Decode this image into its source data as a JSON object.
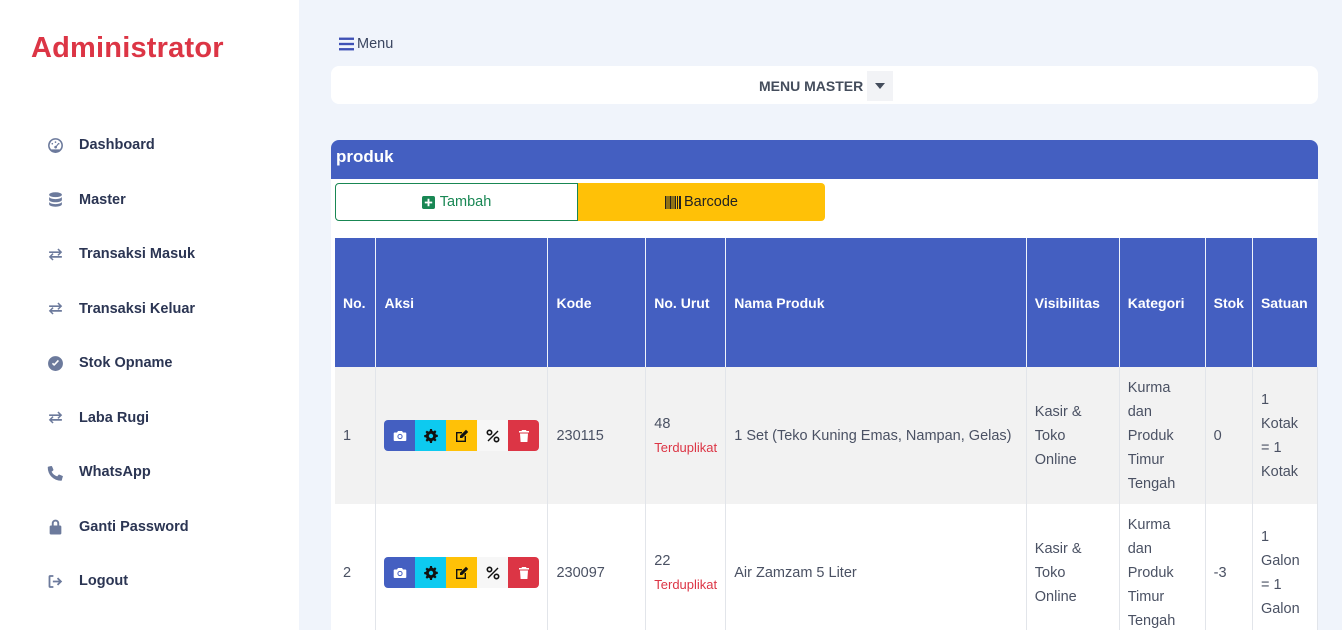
{
  "sidebar": {
    "brand": "Administrator",
    "items": [
      {
        "label": "Dashboard",
        "icon": "dashboard-icon"
      },
      {
        "label": "Master",
        "icon": "database-icon"
      },
      {
        "label": "Transaksi Masuk",
        "icon": "exchange-icon"
      },
      {
        "label": "Transaksi Keluar",
        "icon": "exchange-icon"
      },
      {
        "label": "Stok Opname",
        "icon": "check-circle-icon"
      },
      {
        "label": "Laba Rugi",
        "icon": "exchange-icon"
      },
      {
        "label": "WhatsApp",
        "icon": "phone-icon"
      },
      {
        "label": "Ganti Password",
        "icon": "lock-icon"
      },
      {
        "label": "Logout",
        "icon": "logout-icon"
      }
    ]
  },
  "topbar": {
    "menu_label": "Menu",
    "master_dropdown": "MENU MASTER"
  },
  "card": {
    "title": "produk",
    "btn_tambah": "Tambah",
    "btn_barcode": "Barcode"
  },
  "table": {
    "headers": [
      "No.",
      "Aksi",
      "Kode",
      "No. Urut",
      "Nama Produk",
      "Visibilitas",
      "Kategori",
      "Stok",
      "Satuan"
    ],
    "rows": [
      {
        "no": "1",
        "kode": "230115",
        "urut": "48",
        "urut_note": "Terduplikat",
        "nama": "1 Set (Teko Kuning Emas, Nampan, Gelas)",
        "visibilitas": "Kasir & Toko Online",
        "kategori": "Kurma dan Produk Timur Tengah",
        "stok": "0",
        "satuan": "1 Kotak = 1 Kotak"
      },
      {
        "no": "2",
        "kode": "230097",
        "urut": "22",
        "urut_note": "Terduplikat",
        "nama": "Air Zamzam 5 Liter",
        "visibilitas": "Kasir & Toko Online",
        "kategori": "Kurma dan Produk Timur Tengah",
        "stok": "-3",
        "satuan": "1 Galon = 1 Galon"
      }
    ]
  },
  "colors": {
    "primary": "#445fc1",
    "danger": "#dc3545",
    "warning": "#ffc107",
    "info": "#0dcaf0",
    "success": "#198754"
  }
}
